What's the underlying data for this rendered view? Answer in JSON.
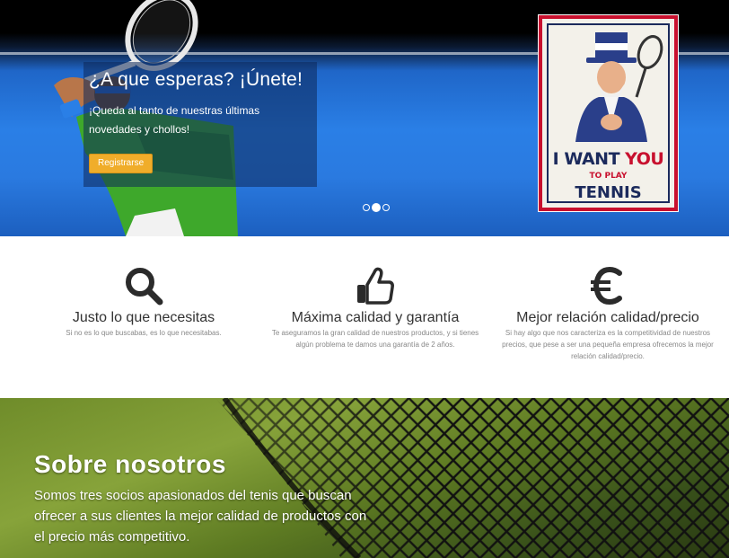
{
  "hero": {
    "caption_title": "¿A que esperas? ¡Únete!",
    "caption_text": "¡Queda al tanto de nuestras últimas novedades y chollos!",
    "register_button": "Registrarse",
    "poster": {
      "line1_prefix": "I WANT ",
      "line1_highlight": "YOU",
      "line2": "TO PLAY",
      "line3": "TENNIS"
    },
    "slides_count": 3,
    "active_slide": 2
  },
  "features": [
    {
      "icon": "search-icon",
      "title": "Justo lo que necesitas",
      "description": "Si no es lo que buscabas, es lo que necesitabas."
    },
    {
      "icon": "thumbs-up-icon",
      "title": "Máxima calidad y garantía",
      "description": "Te aseguramos la gran calidad de nuestros productos, y si tienes algún problema te damos una garantía de 2 años."
    },
    {
      "icon": "euro-icon",
      "title": "Mejor relación calidad/precio",
      "description": "Si hay algo que nos caracteriza es la competitividad de nuestros precios, que pese a ser una pequeña empresa ofrecemos la mejor relación calidad/precio."
    }
  ],
  "about": {
    "title": "Sobre nosotros",
    "text": "Somos tres socios apasionados del tenis que buscan ofrecer a sus clientes la mejor calidad de productos con el precio más competitivo."
  },
  "colors": {
    "accent_button": "#f0ad2a",
    "court_blue": "#2a7fe6",
    "grass_green": "#6f8c2a"
  }
}
